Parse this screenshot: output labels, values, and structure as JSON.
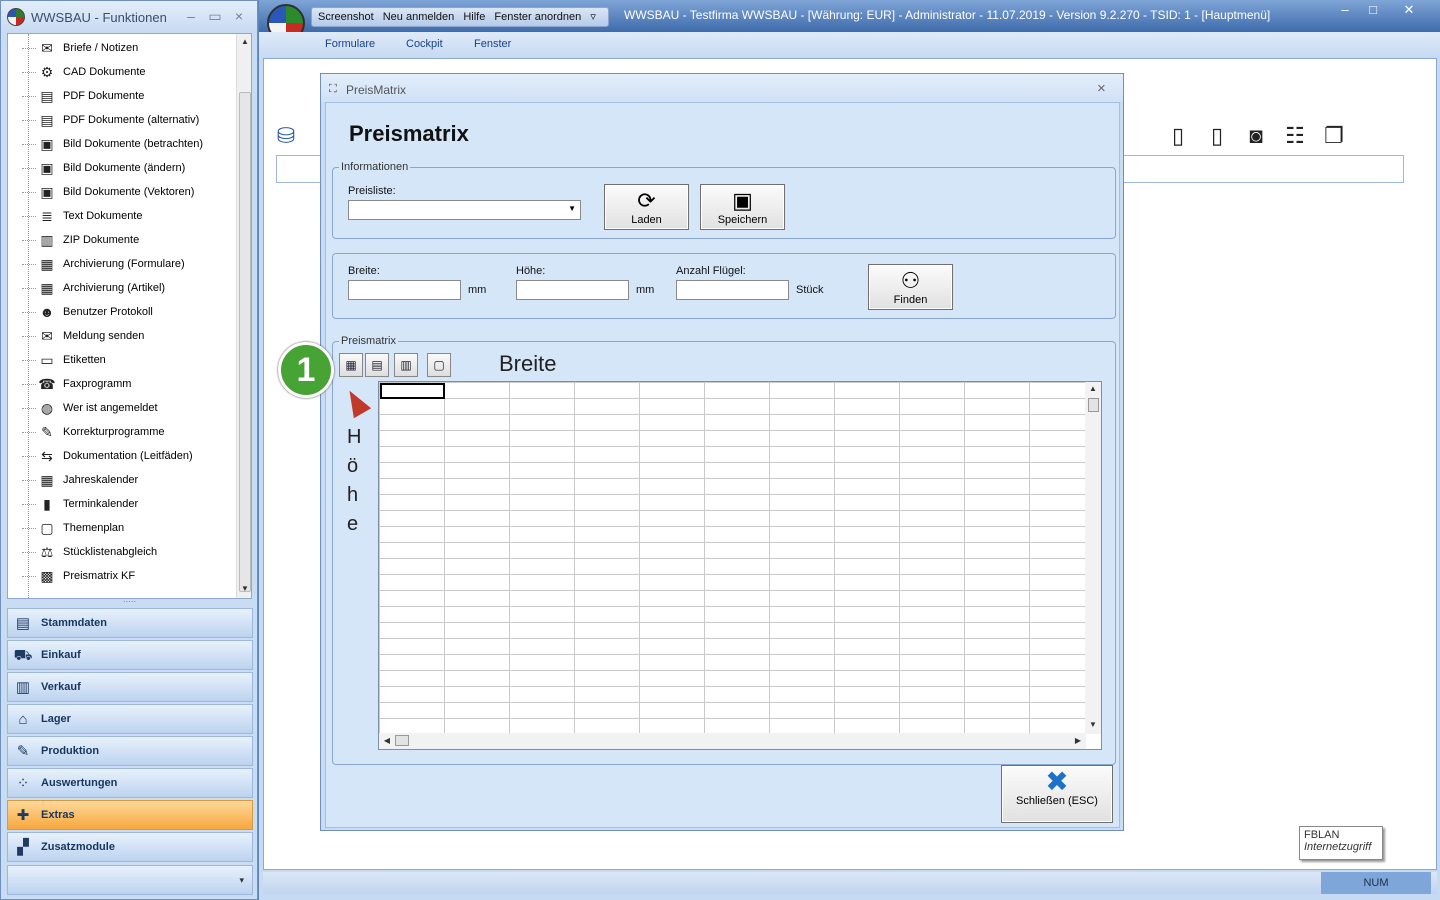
{
  "left_window": {
    "title": "WWSBAU - Funktionen",
    "minimize": "–",
    "maximize": "▭",
    "close": "×",
    "tree_items": [
      {
        "label": "Briefe / Notizen",
        "icon": "envelope-icon"
      },
      {
        "label": "CAD Dokumente",
        "icon": "cad-icon"
      },
      {
        "label": "PDF Dokumente",
        "icon": "document-icon"
      },
      {
        "label": "PDF Dokumente (alternativ)",
        "icon": "document-icon"
      },
      {
        "label": "Bild Dokumente (betrachten)",
        "icon": "image-icon"
      },
      {
        "label": "Bild Dokumente (ändern)",
        "icon": "image-icon"
      },
      {
        "label": "Bild Dokumente (Vektoren)",
        "icon": "image-icon"
      },
      {
        "label": "Text Dokumente",
        "icon": "text-document-icon"
      },
      {
        "label": "ZIP Dokumente",
        "icon": "zip-icon"
      },
      {
        "label": "Archivierung (Formulare)",
        "icon": "archive-icon"
      },
      {
        "label": "Archivierung (Artikel)",
        "icon": "archive-icon"
      },
      {
        "label": "Benutzer Protokoll",
        "icon": "users-icon"
      },
      {
        "label": "Meldung senden",
        "icon": "envelope-icon"
      },
      {
        "label": "Etiketten",
        "icon": "label-icon"
      },
      {
        "label": "Faxprogramm",
        "icon": "fax-icon"
      },
      {
        "label": "Wer ist angemeldet",
        "icon": "globe-user-icon"
      },
      {
        "label": "Korrekturprogramme",
        "icon": "tools-icon"
      },
      {
        "label": "Dokumentation (Leitfäden)",
        "icon": "signpost-icon"
      },
      {
        "label": "Jahreskalender",
        "icon": "calendar-icon"
      },
      {
        "label": "Terminkalender",
        "icon": "bookmark-calendar-icon"
      },
      {
        "label": "Themenplan",
        "icon": "presentation-icon"
      },
      {
        "label": "Stücklistenabgleich",
        "icon": "scale-icon"
      },
      {
        "label": "Preismatrix KF",
        "icon": "matrix-icon"
      }
    ],
    "nav_items": [
      {
        "label": "Stammdaten",
        "icon": "masterdata-icon"
      },
      {
        "label": "Einkauf",
        "icon": "cart-icon"
      },
      {
        "label": "Verkauf",
        "icon": "register-icon"
      },
      {
        "label": "Lager",
        "icon": "warehouse-icon"
      },
      {
        "label": "Produktion",
        "icon": "production-icon"
      },
      {
        "label": "Auswertungen",
        "icon": "analytics-icon"
      },
      {
        "label": "Extras",
        "icon": "extras-icon",
        "active": true
      },
      {
        "label": "Zusatzmodule",
        "icon": "modules-icon"
      }
    ],
    "nav_footer": "▾"
  },
  "main_window": {
    "quick_access": [
      "Screenshot",
      "Neu anmelden",
      "Hilfe",
      "Fenster anordnen",
      "▿"
    ],
    "caption": "WWSBAU - Testfirma WWSBAU - [Währung: EUR] - Administrator - 11.07.2019 - Version 9.2.270  - TSID: 1  - [Hauptmenü]",
    "minimize": "–",
    "maximize": "□",
    "close": "✕",
    "ribbon_tabs": [
      "Formulare",
      "Cockpit",
      "Fenster"
    ],
    "status_num": "NUM",
    "network_tooltip": {
      "title": "FBLAN",
      "subtitle": "Internetzugriff"
    }
  },
  "dialog": {
    "title": "PreisMatrix",
    "close": "×",
    "heading": "Preismatrix",
    "info_group": {
      "legend": "Informationen",
      "price_list_label": "Preisliste:",
      "price_list_value": "",
      "load_button": "Laden",
      "save_button": "Speichern"
    },
    "dimensions_group": {
      "width_label": "Breite:",
      "width_value": "",
      "width_unit": "mm",
      "height_label": "Höhe:",
      "height_value": "",
      "height_unit": "mm",
      "wings_label": "Anzahl Flügel:",
      "wings_value": "",
      "wings_unit": "Stück",
      "find_button": "Finden"
    },
    "matrix_group": {
      "legend": "Preismatrix",
      "column_axis_label": "Breite",
      "row_axis_letters": [
        "H",
        "ö",
        "h",
        "e"
      ]
    },
    "close_button": "Schließen (ESC)"
  },
  "annotation": {
    "step_number": "1"
  }
}
